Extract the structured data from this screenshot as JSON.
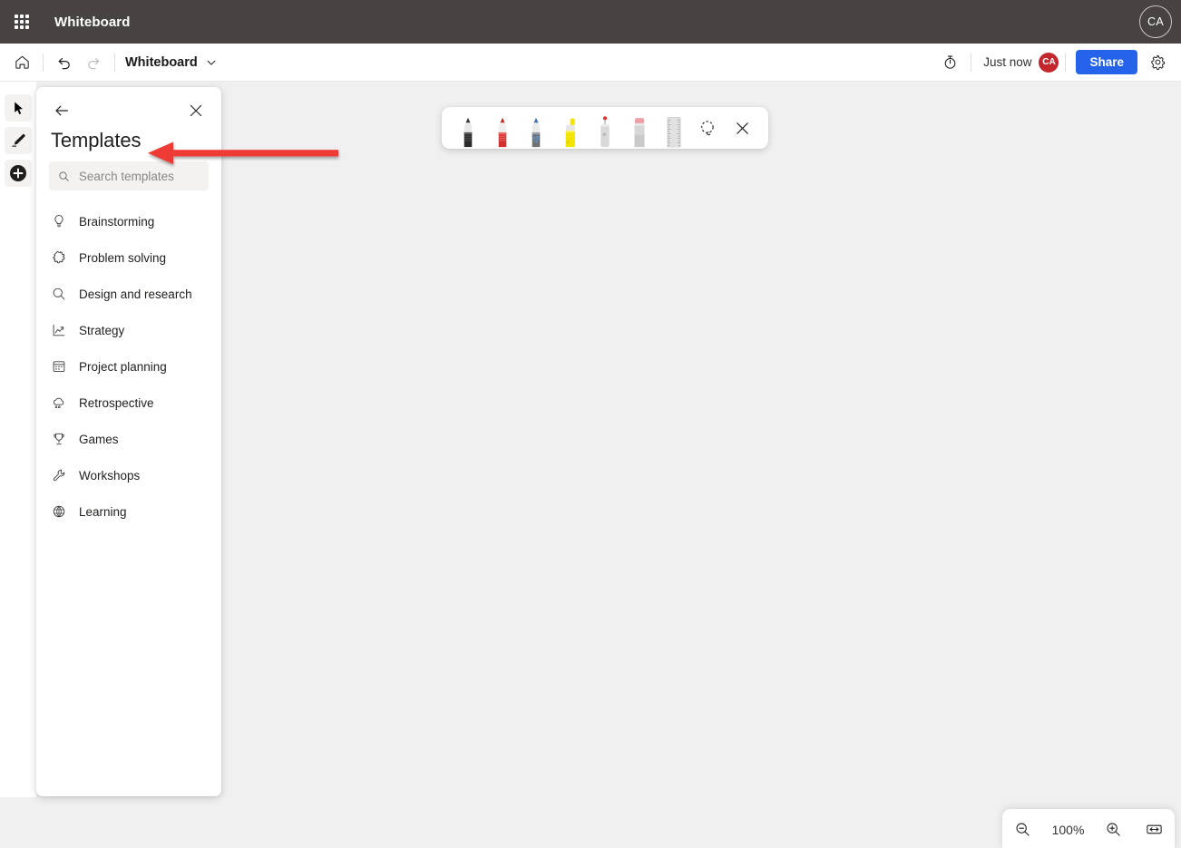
{
  "suite_header": {
    "waffle_label": "app-launcher",
    "app_title": "Whiteboard",
    "avatar_initials": "CA"
  },
  "app_bar": {
    "home_label": "Home",
    "undo_label": "Undo",
    "redo_label": "Redo",
    "document_name": "Whiteboard",
    "dropdown_label": "More document options",
    "timer_label": "Timer",
    "save_status": "Just now",
    "presence_initials": "CA",
    "share_label": "Share",
    "settings_label": "Settings"
  },
  "left_rail": {
    "items": [
      {
        "name": "select-tool",
        "label": "Select"
      },
      {
        "name": "ink-tool",
        "label": "Inking"
      },
      {
        "name": "create-tool",
        "label": "Create"
      }
    ]
  },
  "panel": {
    "back_label": "Back",
    "close_label": "Close",
    "title": "Templates",
    "search": {
      "placeholder": "Search templates",
      "value": ""
    },
    "categories": [
      {
        "icon": "lightbulb-icon",
        "label": "Brainstorming"
      },
      {
        "icon": "puzzle-icon",
        "label": "Problem solving"
      },
      {
        "icon": "magnifier-icon",
        "label": "Design and research"
      },
      {
        "icon": "trend-chart-icon",
        "label": "Strategy"
      },
      {
        "icon": "calendar-icon",
        "label": "Project planning"
      },
      {
        "icon": "cloud-rain-icon",
        "label": "Retrospective"
      },
      {
        "icon": "trophy-icon",
        "label": "Games"
      },
      {
        "icon": "wrench-icon",
        "label": "Workshops"
      },
      {
        "icon": "brain-icon",
        "label": "Learning"
      }
    ]
  },
  "pen_toolbar": {
    "tools": [
      {
        "name": "pen-black",
        "label": "Black pen",
        "type": "pen",
        "color": "#2b2b2b"
      },
      {
        "name": "pen-red",
        "label": "Red pen",
        "type": "pen",
        "color": "#d32f2f"
      },
      {
        "name": "pen-blue",
        "label": "Blue pen",
        "type": "pen",
        "color": "#3f6fb5"
      },
      {
        "name": "highlighter-yellow",
        "label": "Yellow highlighter",
        "type": "highlighter",
        "color": "#f4e500"
      },
      {
        "name": "laser-pointer",
        "label": "Laser pointer",
        "type": "laser",
        "color": "#e33030"
      },
      {
        "name": "eraser",
        "label": "Eraser",
        "type": "eraser",
        "color": "#f0a8b0"
      },
      {
        "name": "ruler",
        "label": "Ruler",
        "type": "ruler",
        "color": "#d7d7d7"
      }
    ],
    "lasso_label": "Lasso select",
    "close_label": "Close inking toolbar"
  },
  "annotation": {
    "type": "arrow",
    "color": "#ef3b36",
    "direction": "left",
    "points_to": "Templates"
  },
  "zoom_controls": {
    "zoom_out_label": "Zoom out",
    "zoom_level": "100%",
    "zoom_in_label": "Zoom in",
    "fit_label": "Fit to screen"
  },
  "colors": {
    "suite_header_bg": "#464342",
    "canvas_bg": "#f0f0f0",
    "share_blue": "#2563eb",
    "presence_red": "#c4262e",
    "annotation_red": "#ef3b36"
  }
}
